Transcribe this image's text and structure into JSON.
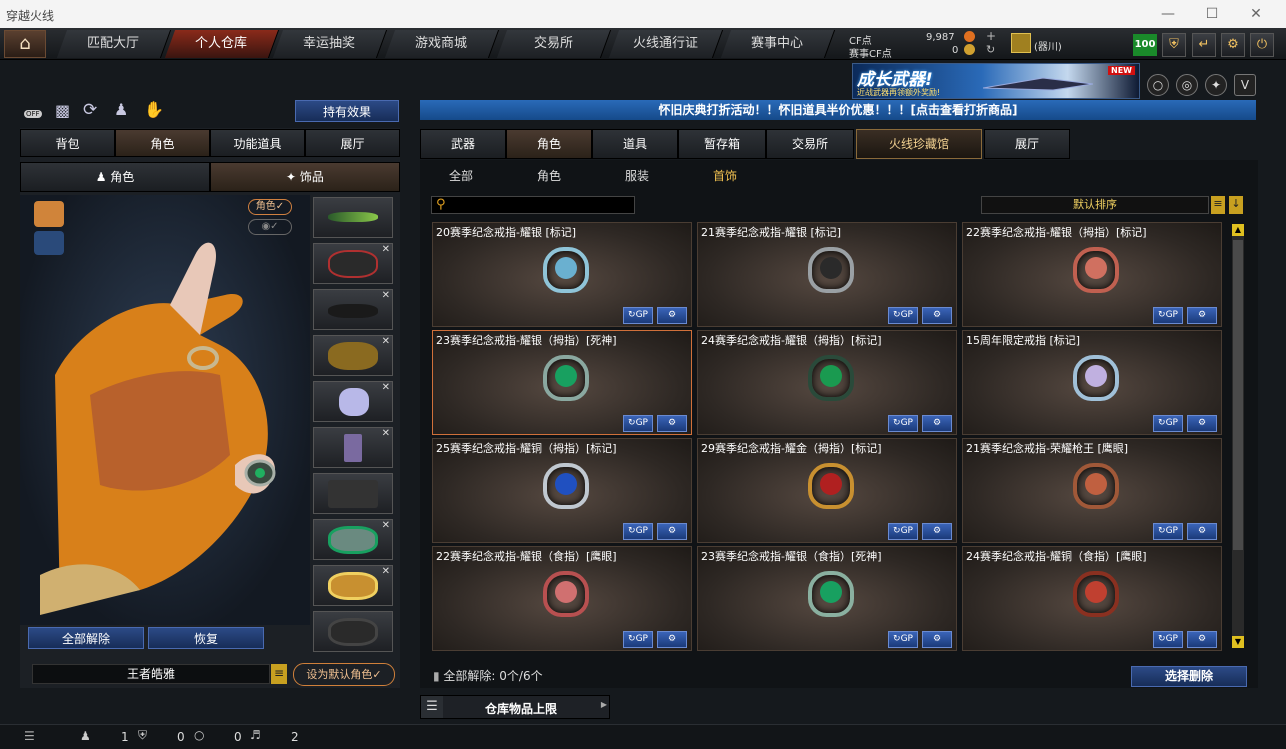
{
  "window": {
    "title": "穿越火线"
  },
  "nav": {
    "tabs": [
      "匹配大厅",
      "个人仓库",
      "幸运抽奖",
      "游戏商城",
      "交易所",
      "火线通行证",
      "赛事中心"
    ],
    "active": "个人仓库"
  },
  "currency": {
    "cf_label": "CF点",
    "cf_value": "9,987",
    "match_label": "赛事CF点",
    "match_value": "0"
  },
  "user": {
    "name": "(器川)",
    "level": "100"
  },
  "banner": {
    "title": "成长武器!",
    "subtitle": "近战武器再领额外奖励!",
    "badge": "NEW"
  },
  "announcement": "怀旧庆典打折活动！！怀旧道具半价优惠！！！[点击查看打折商品]",
  "left": {
    "effect_button": "持有效果",
    "off_label": "OFF",
    "tabs": [
      "背包",
      "角色",
      "功能道具",
      "展厅"
    ],
    "active_tab": "角色",
    "subtabs": [
      "角色",
      "饰品"
    ],
    "toggle_label": "角色",
    "clear_all": "全部解除",
    "restore": "恢复",
    "char_name": "王者皓雅",
    "set_default": "设为默认角色"
  },
  "right": {
    "tabs": [
      "武器",
      "角色",
      "道具",
      "暂存箱",
      "交易所",
      "火线珍藏馆",
      "展厅"
    ],
    "active_tab": "角色",
    "subtabs": [
      "全部",
      "角色",
      "服装",
      "首饰"
    ],
    "active_subtab": "首饰",
    "sort_label": "默认排序",
    "gp_label": "GP",
    "items": [
      {
        "name": "20赛季纪念戒指-耀银 [标记]",
        "ring": "#8fc4d8",
        "gem": "#6ab0d0"
      },
      {
        "name": "21赛季纪念戒指-耀银 [标记]",
        "ring": "#9aa0a4",
        "gem": "#2a2a2a"
      },
      {
        "name": "22赛季纪念戒指-耀银（拇指）[标记]",
        "ring": "#c06050",
        "gem": "#d07060"
      },
      {
        "name": "23赛季纪念戒指-耀银（拇指）[死神]",
        "ring": "#8aa8a0",
        "gem": "#18a060"
      },
      {
        "name": "24赛季纪念戒指-耀银（拇指）[标记]",
        "ring": "#2a4a3a",
        "gem": "#1a9a50"
      },
      {
        "name": "15周年限定戒指 [标记]",
        "ring": "#a0c0d8",
        "gem": "#c0b0e0"
      },
      {
        "name": "25赛季纪念戒指-耀铜（拇指）[标记]",
        "ring": "#c0c8d0",
        "gem": "#2050c0"
      },
      {
        "name": "29赛季纪念戒指-耀金（拇指）[标记]",
        "ring": "#c89030",
        "gem": "#b02020"
      },
      {
        "name": "21赛季纪念戒指-荣耀枪王 [鹰眼]",
        "ring": "#a05838",
        "gem": "#c06040"
      },
      {
        "name": "22赛季纪念戒指-耀银（食指）[鹰眼]",
        "ring": "#b85050",
        "gem": "#d07070"
      },
      {
        "name": "23赛季纪念戒指-耀银（食指）[死神]",
        "ring": "#8ab0a0",
        "gem": "#18a060"
      },
      {
        "name": "24赛季纪念戒指-耀铜（食指）[鹰眼]",
        "ring": "#8a3020",
        "gem": "#c04030"
      }
    ],
    "footer_clear": "全部解除: 0个/6个",
    "select_delete": "选择删除",
    "storage_limit": "仓库物品上限"
  },
  "status": {
    "friends": "1",
    "shield": "0",
    "chat": "0",
    "volume": "2"
  }
}
